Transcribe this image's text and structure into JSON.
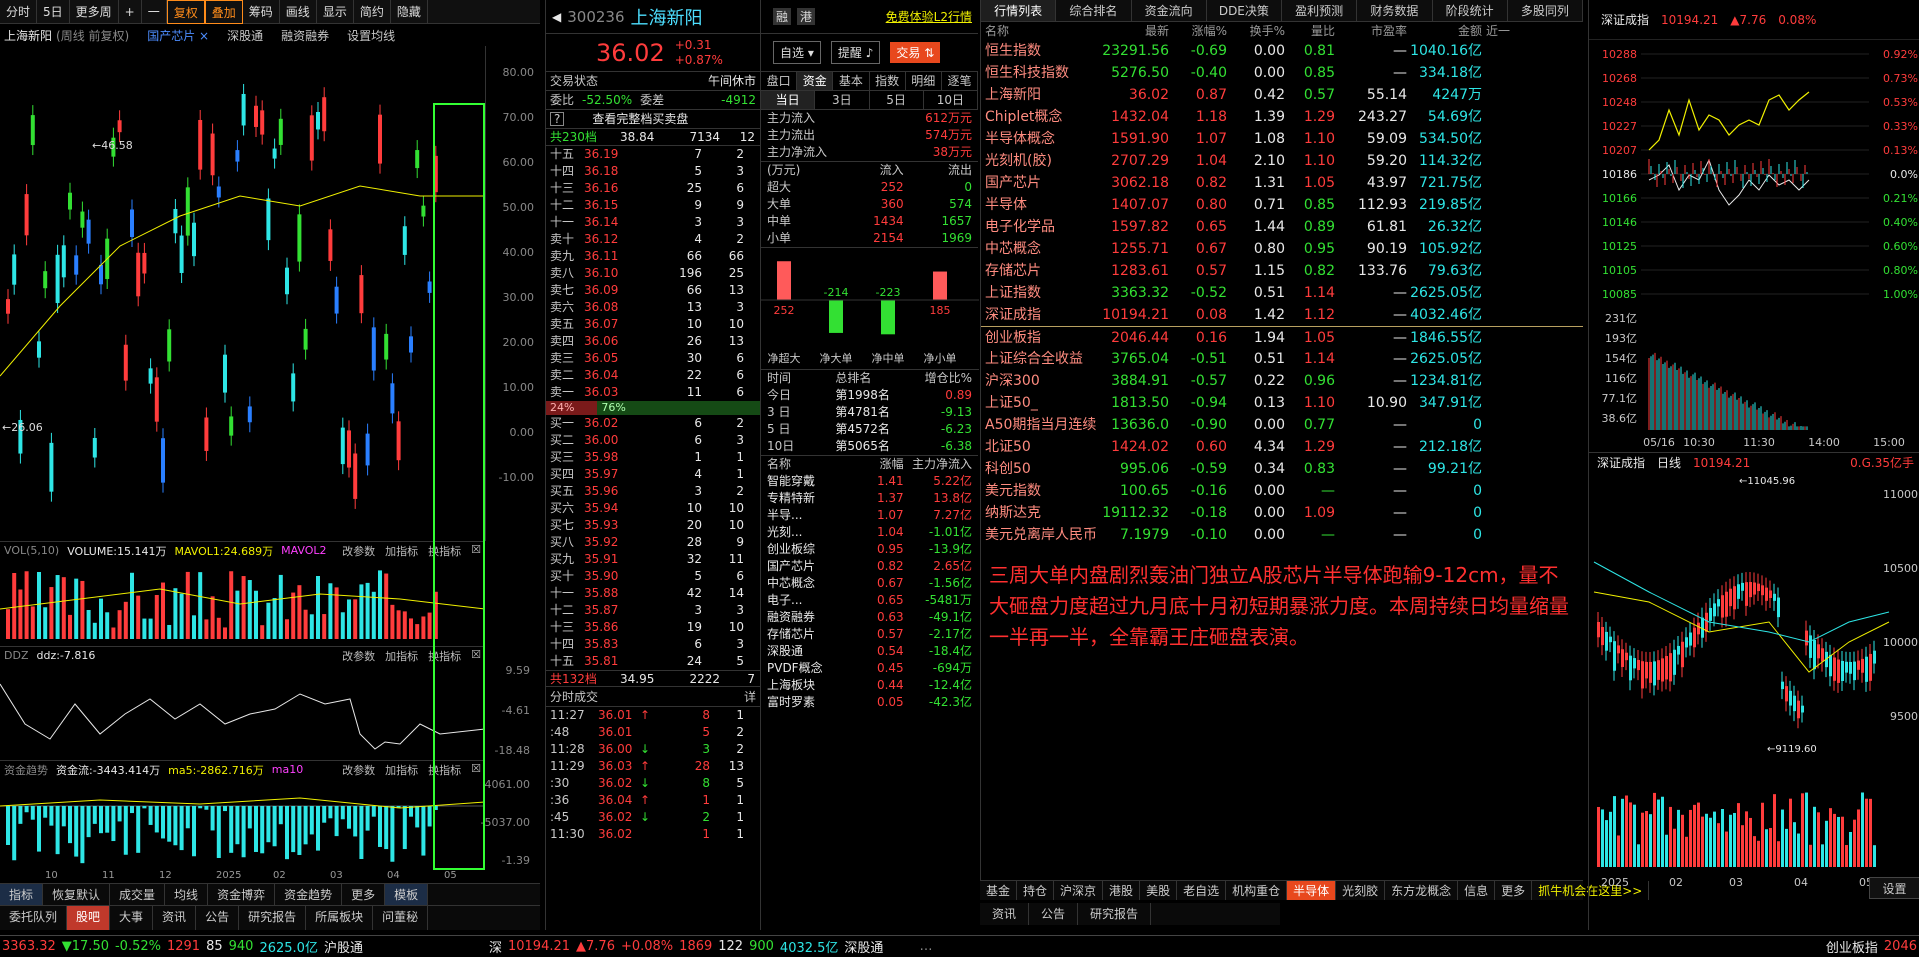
{
  "toolbar": {
    "items": [
      "分时",
      "5日",
      "更多周",
      "+",
      "一",
      "复权",
      "叠加",
      "筹码",
      "画线",
      "显示",
      "简约",
      "隐藏"
    ]
  },
  "chart_info": {
    "name": "上海新阳",
    "period": "(周线 前复权)",
    "concept": "国产芯片",
    "concept_x": "×",
    "links": [
      "深股通",
      "融资融券",
      "设置均线"
    ]
  },
  "kline_axis": [
    "80.00",
    "70.00",
    "60.00",
    "50.00",
    "40.00",
    "30.00",
    "20.00",
    "10.00",
    "0.00",
    "-10.00"
  ],
  "kline_labels": {
    "high": "46.58",
    "low": "26.06"
  },
  "vol_panel": {
    "title": "VOL(5,10)",
    "vol": "VOLUME:15.141万",
    "mavol1": "MAVOL1:24.689万",
    "mavol2": "MAVOL2",
    "tools": [
      "改参数",
      "加指标",
      "换指标"
    ]
  },
  "ddz_panel": {
    "title": "DDZ",
    "ddz": "ddz:-7.816",
    "axis": [
      "9.59",
      "-4.61",
      "-18.48"
    ],
    "tools": [
      "改参数",
      "加指标",
      "换指标"
    ]
  },
  "fund_panel": {
    "title": "资金趋势",
    "flow": "资金流:-3443.414万",
    "ma5": "ma5:-2862.716万",
    "ma10": "ma10",
    "axis": [
      "4061.00",
      "-5037.00",
      "-1.39"
    ],
    "tools": [
      "改参数",
      "加指标",
      "换指标"
    ]
  },
  "x_axis": [
    "10",
    "11",
    "12",
    "2025",
    "02",
    "03",
    "04",
    "05"
  ],
  "left_tabs": [
    "指标",
    "恢复默认",
    "成交量",
    "均线",
    "资金博弈",
    "资金趋势",
    "更多",
    "模板"
  ],
  "left_tabs2": [
    "委托队列",
    "股吧",
    "大事",
    "资讯",
    "公告",
    "研究报告",
    "所属板块",
    "问董秘"
  ],
  "stock": {
    "code": "300236",
    "name": "上海新阳",
    "price": "36.02",
    "chg": "+0.31",
    "pct": "+0.87%",
    "rong": "融",
    "gang": "港",
    "l2": "免费体验L2行情",
    "zixuan": "自选",
    "tixing": "提醒",
    "jiaoyi": "交易"
  },
  "status_row": {
    "label": "交易状态",
    "value": "午间休市"
  },
  "weibi": {
    "label": "委比",
    "value": "-52.50%",
    "label2": "委差",
    "value2": "-4912"
  },
  "full_order": "查看完整档买卖盘",
  "sell_total": {
    "label": "共230档",
    "price": "38.84",
    "vol": "7134",
    "n": "12"
  },
  "asks": [
    [
      "十五",
      "36.19",
      "7",
      "2"
    ],
    [
      "十四",
      "36.18",
      "5",
      "3"
    ],
    [
      "十三",
      "36.16",
      "25",
      "6"
    ],
    [
      "十二",
      "36.15",
      "9",
      "9"
    ],
    [
      "十一",
      "36.14",
      "3",
      "3"
    ],
    [
      "卖十",
      "36.12",
      "4",
      "2"
    ],
    [
      "卖九",
      "36.11",
      "66",
      "66"
    ],
    [
      "卖八",
      "36.10",
      "196",
      "25"
    ],
    [
      "卖七",
      "36.09",
      "66",
      "13"
    ],
    [
      "卖六",
      "36.08",
      "13",
      "3"
    ],
    [
      "卖五",
      "36.07",
      "10",
      "10"
    ],
    [
      "卖四",
      "36.06",
      "26",
      "13"
    ],
    [
      "卖三",
      "36.05",
      "30",
      "6"
    ],
    [
      "卖二",
      "36.04",
      "22",
      "6"
    ],
    [
      "卖一",
      "36.03",
      "11",
      "6"
    ]
  ],
  "ratio": {
    "buy": "24%",
    "sell": "76%"
  },
  "bids": [
    [
      "买一",
      "36.02",
      "6",
      "2"
    ],
    [
      "买二",
      "36.00",
      "6",
      "3"
    ],
    [
      "买三",
      "35.98",
      "1",
      "1"
    ],
    [
      "买四",
      "35.97",
      "4",
      "1"
    ],
    [
      "买五",
      "35.96",
      "3",
      "2"
    ],
    [
      "买六",
      "35.94",
      "10",
      "10"
    ],
    [
      "买七",
      "35.93",
      "20",
      "10"
    ],
    [
      "买八",
      "35.92",
      "28",
      "9"
    ],
    [
      "买九",
      "35.91",
      "32",
      "11"
    ],
    [
      "买十",
      "35.90",
      "5",
      "6"
    ],
    [
      "十一",
      "35.88",
      "42",
      "14"
    ],
    [
      "十二",
      "35.87",
      "3",
      "3"
    ],
    [
      "十三",
      "35.86",
      "19",
      "10"
    ],
    [
      "十四",
      "35.83",
      "6",
      "3"
    ],
    [
      "十五",
      "35.81",
      "24",
      "5"
    ]
  ],
  "buy_total": {
    "label": "共132档",
    "price": "34.95",
    "vol": "2222",
    "n": "7"
  },
  "ticks_title": "分时成交",
  "ticks_btn": "详",
  "ticks": [
    [
      "11:27",
      "36.01",
      "↑",
      "8",
      "1"
    ],
    [
      ":48",
      "36.01",
      "",
      "5",
      "2"
    ],
    [
      "11:28",
      "36.00",
      "↓",
      "3",
      "2"
    ],
    [
      "11:29",
      "36.03",
      "↑",
      "28",
      "13"
    ],
    [
      ":30",
      "36.02",
      "↓",
      "8",
      "5"
    ],
    [
      ":36",
      "36.04",
      "↑",
      "1",
      "1"
    ],
    [
      ":45",
      "36.02",
      "↓",
      "2",
      "1"
    ],
    [
      "11:30",
      "36.02",
      "",
      "1",
      "1"
    ]
  ],
  "mid2_tabs": [
    "盘口",
    "资金",
    "基本",
    "指数",
    "明细",
    "逐笔"
  ],
  "period_tabs": [
    "当日",
    "3日",
    "5日",
    "10日"
  ],
  "main_flow": [
    [
      "主力流入",
      "612万元"
    ],
    [
      "主力流出",
      "574万元"
    ],
    [
      "主力净流入",
      "38万元"
    ]
  ],
  "flow_table": {
    "head": [
      "(万元)",
      "流入",
      "流出"
    ],
    "rows": [
      [
        "超大",
        "252",
        "0"
      ],
      [
        "大单",
        "360",
        "574"
      ],
      [
        "中单",
        "1434",
        "1657"
      ],
      [
        "小单",
        "2154",
        "1969"
      ]
    ]
  },
  "flow_bars": {
    "values": [
      "252",
      "-214",
      "-223",
      "185"
    ],
    "labels": [
      "净超大",
      "净大单",
      "净中单",
      "净小单"
    ]
  },
  "rank": {
    "head": [
      "时间",
      "总排名",
      "增仓比%"
    ],
    "rows": [
      [
        "今日",
        "第1998名",
        "0.89"
      ],
      [
        "3 日",
        "第4781名",
        "-9.13"
      ],
      [
        "5 日",
        "第4572名",
        "-6.23"
      ],
      [
        "10日",
        "第5065名",
        "-6.38"
      ]
    ]
  },
  "sectors": {
    "head": [
      "名称",
      "涨幅",
      "主力净流入"
    ],
    "rows": [
      [
        "智能穿戴",
        "1.41",
        "5.22亿"
      ],
      [
        "专精特新",
        "1.37",
        "13.8亿"
      ],
      [
        "半导...",
        "1.07",
        "7.27亿"
      ],
      [
        "光刻...",
        "1.04",
        "-1.01亿"
      ],
      [
        "创业板综",
        "0.95",
        "-13.9亿"
      ],
      [
        "国产芯片",
        "0.82",
        "2.65亿"
      ],
      [
        "中芯概念",
        "0.67",
        "-1.56亿"
      ],
      [
        "电子...",
        "0.65",
        "-5481万"
      ],
      [
        "融资融券",
        "0.63",
        "-49.1亿"
      ],
      [
        "存储芯片",
        "0.57",
        "-2.17亿"
      ],
      [
        "深股通",
        "0.54",
        "-18.4亿"
      ],
      [
        "PVDF概念",
        "0.45",
        "-694万"
      ],
      [
        "上海板块",
        "0.44",
        "-12.4亿"
      ],
      [
        "富时罗素",
        "0.05",
        "-42.3亿"
      ]
    ]
  },
  "right_tabs": [
    "行情列表",
    "综合排名",
    "资金流向",
    "DDE决策",
    "盈利预测",
    "财务数据",
    "阶段统计",
    "多股同列"
  ],
  "right_head": [
    "名称",
    "最新",
    "涨幅%",
    "换手%",
    "量比",
    "市盈率",
    "金额",
    "近一"
  ],
  "quotes": [
    [
      "恒生指数",
      "23291.56",
      "-0.69",
      "0.00",
      "0.81",
      "—",
      "1040.16亿"
    ],
    [
      "恒生科技指数",
      "5276.50",
      "-0.40",
      "0.00",
      "0.85",
      "—",
      "334.18亿"
    ],
    [
      "上海新阳",
      "36.02",
      "0.87",
      "0.42",
      "0.57",
      "55.14",
      "4247万"
    ],
    [
      "Chiplet概念",
      "1432.04",
      "1.18",
      "1.39",
      "1.29",
      "243.27",
      "54.69亿"
    ],
    [
      "半导体概念",
      "1591.90",
      "1.07",
      "1.08",
      "1.10",
      "59.09",
      "534.50亿"
    ],
    [
      "光刻机(胶)",
      "2707.29",
      "1.04",
      "2.10",
      "1.10",
      "59.20",
      "114.32亿"
    ],
    [
      "国产芯片",
      "3062.18",
      "0.82",
      "1.31",
      "1.05",
      "43.97",
      "721.75亿"
    ],
    [
      "半导体",
      "1407.07",
      "0.80",
      "0.71",
      "0.85",
      "112.93",
      "219.85亿"
    ],
    [
      "电子化学品",
      "1597.82",
      "0.65",
      "1.44",
      "0.89",
      "61.81",
      "26.32亿"
    ],
    [
      "中芯概念",
      "1255.71",
      "0.67",
      "0.80",
      "0.95",
      "90.19",
      "105.92亿"
    ],
    [
      "存储芯片",
      "1283.61",
      "0.57",
      "1.15",
      "0.82",
      "133.76",
      "79.63亿"
    ],
    [
      "上证指数",
      "3363.32",
      "-0.52",
      "0.51",
      "1.14",
      "—",
      "2625.05亿"
    ],
    [
      "深证成指",
      "10194.21",
      "0.08",
      "1.42",
      "1.12",
      "—",
      "4032.46亿"
    ],
    [
      "创业板指",
      "2046.44",
      "0.16",
      "1.94",
      "1.05",
      "—",
      "1846.55亿"
    ],
    [
      "上证综合全收益",
      "3765.04",
      "-0.51",
      "0.51",
      "1.14",
      "—",
      "2625.05亿"
    ],
    [
      "沪深300",
      "3884.91",
      "-0.57",
      "0.22",
      "0.96",
      "—",
      "1234.81亿"
    ],
    [
      "上证50_",
      "1813.50",
      "-0.94",
      "0.13",
      "1.10",
      "10.90",
      "347.91亿"
    ],
    [
      "A50期指当月连续",
      "13636.0",
      "-0.90",
      "0.00",
      "0.77",
      "—",
      "0"
    ],
    [
      "北证50",
      "1424.02",
      "0.60",
      "4.34",
      "1.29",
      "—",
      "212.18亿"
    ],
    [
      "科创50",
      "995.06",
      "-0.59",
      "0.34",
      "0.83",
      "—",
      "99.21亿"
    ],
    [
      "美元指数",
      "100.65",
      "-0.16",
      "0.00",
      "—",
      "—",
      "0"
    ],
    [
      "纳斯达克",
      "19112.32",
      "-0.18",
      "0.00",
      "1.09",
      "—",
      "0"
    ],
    [
      "美元兑离岸人民币",
      "7.1979",
      "-0.10",
      "0.00",
      "—",
      "—",
      "0"
    ]
  ],
  "note": "三周大单内盘剧烈轰油门独立A股芯片半导体跑输9-12cm，量不大砸盘力度超过九月底十月初短期暴涨力度。本周持续日均量缩量一半再一半，全靠霸王庄砸盘表演。",
  "right_bottom_tabs": [
    "基金",
    "持仓",
    "沪深京",
    "港股",
    "美股",
    "老自选",
    "机构重仓",
    "半导体",
    "光刻胶",
    "东方龙概念",
    "信息",
    "更多",
    "抓牛机会在这里>>"
  ],
  "right_bottom_tabs2": [
    "资讯",
    "公告",
    "研究报告"
  ],
  "far_top": {
    "title": "深证成指",
    "price": "10194.21",
    "chg": "7.76",
    "pct": "0.08%",
    "axis": [
      "10288",
      "10268",
      "10248",
      "10227",
      "10207",
      "10186",
      "10166",
      "10146",
      "10125",
      "10105",
      "10085"
    ],
    "raxis": [
      "0.92%",
      "0.73%",
      "0.53%",
      "0.33%",
      "0.13%",
      "0.0%",
      "0.21%",
      "0.40%",
      "0.60%",
      "0.80%",
      "1.00%"
    ],
    "vol_axis": [
      "231亿",
      "193亿",
      "154亿",
      "116亿",
      "77.1亿",
      "38.6亿"
    ],
    "times": [
      "05/16",
      "10:30",
      "11:30",
      "14:00",
      "15:00"
    ]
  },
  "far_bottom": {
    "title": "深证成指",
    "period": "日线",
    "price": "10194.21",
    "extra": "0.G.35亿手",
    "axis": [
      "11000",
      "10500",
      "10000",
      "9500"
    ],
    "high": "11045.96",
    "low": "9119.60",
    "times": [
      "2025",
      "02",
      "03",
      "04",
      "05"
    ]
  },
  "far_tab": "设置",
  "status": {
    "sh": "3363.32",
    "sh_chg": "17.50",
    "sh_pct": "-0.52%",
    "up": "1291",
    "flat": "85",
    "down": "940",
    "amt": "2625.0亿",
    "hgt": "沪股通",
    "sz": "深",
    "sz_idx": "10194.21",
    "sz_chg": "7.76",
    "sz_pct": "+0.08%",
    "sz_up": "1869",
    "sz_flat": "122",
    "sz_down": "900",
    "sz_amt": "4032.5亿",
    "sgt": "深股通",
    "tail": "创业板指",
    "tail_val": "2046"
  },
  "colors": {
    "up": "#ff3c3c",
    "down": "#33e033",
    "cyan": "#2ee6e6",
    "highlight": "#33ff33",
    "accent": "#ff8c1a"
  }
}
